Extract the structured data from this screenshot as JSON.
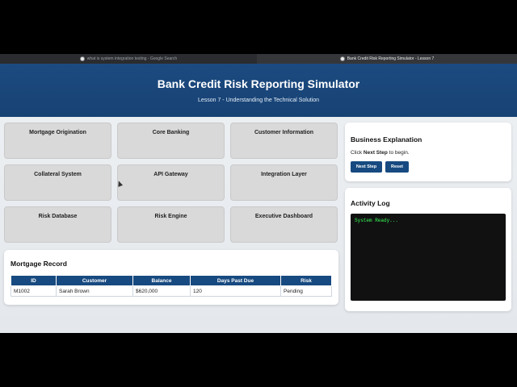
{
  "browser": {
    "tabs": [
      {
        "label": "what is system integration testing - Google Search",
        "active": false
      },
      {
        "label": "Bank Credit Risk Reporting Simulator - Lesson 7",
        "active": true
      }
    ]
  },
  "header": {
    "title": "Bank Credit Risk Reporting Simulator",
    "subtitle": "Lesson 7 - Understanding the Technical Solution"
  },
  "systems": [
    "Mortgage Origination",
    "Core Banking",
    "Customer Information",
    "Collateral System",
    "API Gateway",
    "Integration Layer",
    "Risk Database",
    "Risk Engine",
    "Executive Dashboard"
  ],
  "record": {
    "title": "Mortgage Record",
    "columns": [
      "ID",
      "Customer",
      "Balance",
      "Days Past Due",
      "Risk"
    ],
    "rows": [
      [
        "M1002",
        "Sarah Brown",
        "$620,000",
        "120",
        "Pending"
      ]
    ]
  },
  "explanation": {
    "title": "Business Explanation",
    "text_prefix": "Click ",
    "text_bold": "Next Step",
    "text_suffix": " to begin.",
    "next_label": "Next Step",
    "reset_label": "Reset"
  },
  "log": {
    "title": "Activity Log",
    "lines": [
      "System Ready..."
    ]
  },
  "colors": {
    "header_blue": "#1c4a80",
    "button_blue": "#174a80",
    "console_text": "#39ff5a"
  }
}
